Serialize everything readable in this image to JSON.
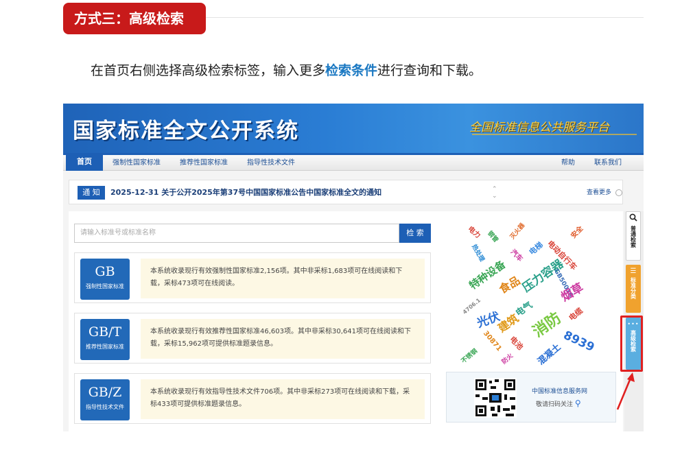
{
  "section": {
    "title": "方式三：高级检索",
    "intro_before": "在首页右侧选择高级检索标签，输入更多",
    "intro_highlight": "检索条件",
    "intro_after": "进行查询和下载。"
  },
  "site": {
    "title": "国家标准全文公开系统",
    "slogan": "全国标准信息公共服务平台",
    "nav": {
      "home": "首页",
      "items": [
        "强制性国家标准",
        "推荐性国家标准",
        "指导性技术文件"
      ],
      "help": "帮助",
      "contact": "联系我们"
    },
    "notice": {
      "tag": "通 知",
      "text": "2025-12-31  关于公开2025年第37号中国国家标准公告中国家标准全文的通知",
      "more": "查看更多"
    },
    "search": {
      "placeholder": "请输入标准号或标准名称",
      "button": "检 索"
    },
    "cards": [
      {
        "code": "GB",
        "name": "强制性国家标准",
        "desc": "本系统收录现行有效强制性国家标准2,156项。其中非采标1,683项可在线阅读和下载，采标473项可在线阅读。"
      },
      {
        "code": "GB/T",
        "name": "推荐性国家标准",
        "desc": "本系统收录现行有效推荐性国家标准46,603项。其中非采标30,641项可在线阅读和下载，采标15,962项可提供标准题录信息。"
      },
      {
        "code": "GB/Z",
        "name": "指导性技术文件",
        "desc": "本系统收录现行有效指导性技术文件706项。其中非采标273项可在线阅读和下载，采标433项可提供标准题录信息。"
      }
    ],
    "word_cloud": [
      "电力",
      "钢管",
      "灭火器",
      "安全",
      "热处理",
      "汽车",
      "电梯",
      "电动自行车",
      "特种设备",
      "食品",
      "压力容器",
      "GB50016",
      "烟草",
      "光伏",
      "建筑",
      "电气",
      "消防",
      "电缆",
      "30871",
      "电池",
      "8939",
      "不锈钢",
      "防火",
      "混凝土",
      "4706.1"
    ],
    "qr": {
      "title": "中国标准信息服务网",
      "subtitle": "敬请扫码关注"
    },
    "rail": {
      "normal": "普通检索",
      "category": "标准分类",
      "advanced": "高级检索"
    }
  },
  "colors": {
    "brand_red": "#c81a1a",
    "site_blue": "#1d5fb5",
    "highlight_blue": "#1a78c2",
    "callout_red": "#e02020",
    "category_orange": "#f0a22e",
    "advanced_blue": "#5aaee0"
  }
}
